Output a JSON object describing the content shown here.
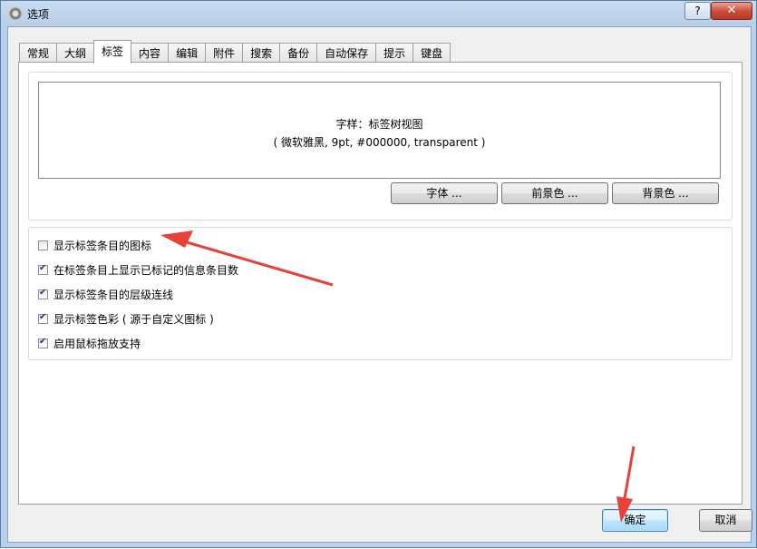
{
  "window": {
    "title": "选项",
    "help_label": "?",
    "close_label": "✕"
  },
  "tabs": [
    {
      "label": "常规",
      "active": false
    },
    {
      "label": "大纲",
      "active": false
    },
    {
      "label": "标签",
      "active": true
    },
    {
      "label": "内容",
      "active": false
    },
    {
      "label": "编辑",
      "active": false
    },
    {
      "label": "附件",
      "active": false
    },
    {
      "label": "搜索",
      "active": false
    },
    {
      "label": "备份",
      "active": false
    },
    {
      "label": "自动保存",
      "active": false
    },
    {
      "label": "提示",
      "active": false
    },
    {
      "label": "键盘",
      "active": false
    }
  ],
  "style_preview": {
    "line1": "字样：标签树视图",
    "line2": "( 微软雅黑, 9pt, #000000, transparent )"
  },
  "style_buttons": {
    "font": "字体 ...",
    "foreground": "前景色 ...",
    "background": "背景色 ..."
  },
  "checkboxes": [
    {
      "label": "显示标签条目的图标",
      "checked": false
    },
    {
      "label": "在标签条目上显示已标记的信息条目数",
      "checked": true
    },
    {
      "label": "显示标签条目的层级连线",
      "checked": true
    },
    {
      "label": "显示标签色彩 ( 源于自定义图标 )",
      "checked": true
    },
    {
      "label": "启用鼠标拖放支持",
      "checked": true
    }
  ],
  "footer": {
    "ok_label": "确定",
    "cancel_label": "取消"
  },
  "colors": {
    "annotation_arrow": "#e8413a"
  }
}
